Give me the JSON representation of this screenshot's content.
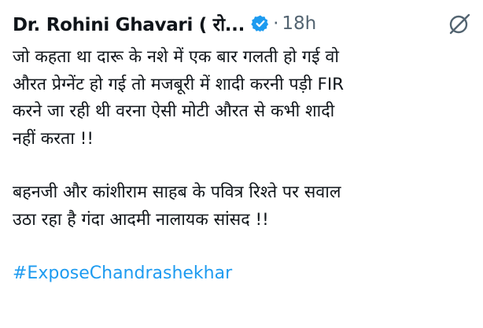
{
  "tweet": {
    "display_name": "Dr. Rohini Ghavari ( रो...",
    "separator": "·",
    "time": "18h",
    "icons": {
      "verified": "verified-badge-icon",
      "grok": "grok-icon"
    },
    "colors": {
      "verified": "#1d9bf0",
      "hashtag": "#1d9bf0",
      "meta": "#536471",
      "text": "#0f1419"
    },
    "paragraph1": {
      "line1": "जो कहता था दारू के नशे में एक बार गलती हो गई वो",
      "line2": "औरत प्रेग्नेंट हो गई तो मजबूरी में शादी करनी पड़ी FIR",
      "line3": "करने जा रही थी वरना ऐसी मोटी औरत से कभी शादी",
      "line4": "नहीं करता !!"
    },
    "paragraph2": {
      "line1": "बहनजी और कांशीराम साहब के पवित्र रिश्ते पर सवाल",
      "line2": "उठा रहा है गंदा आदमी नालायक सांसद !!"
    },
    "hashtag": "#ExposeChandrashekhar"
  }
}
